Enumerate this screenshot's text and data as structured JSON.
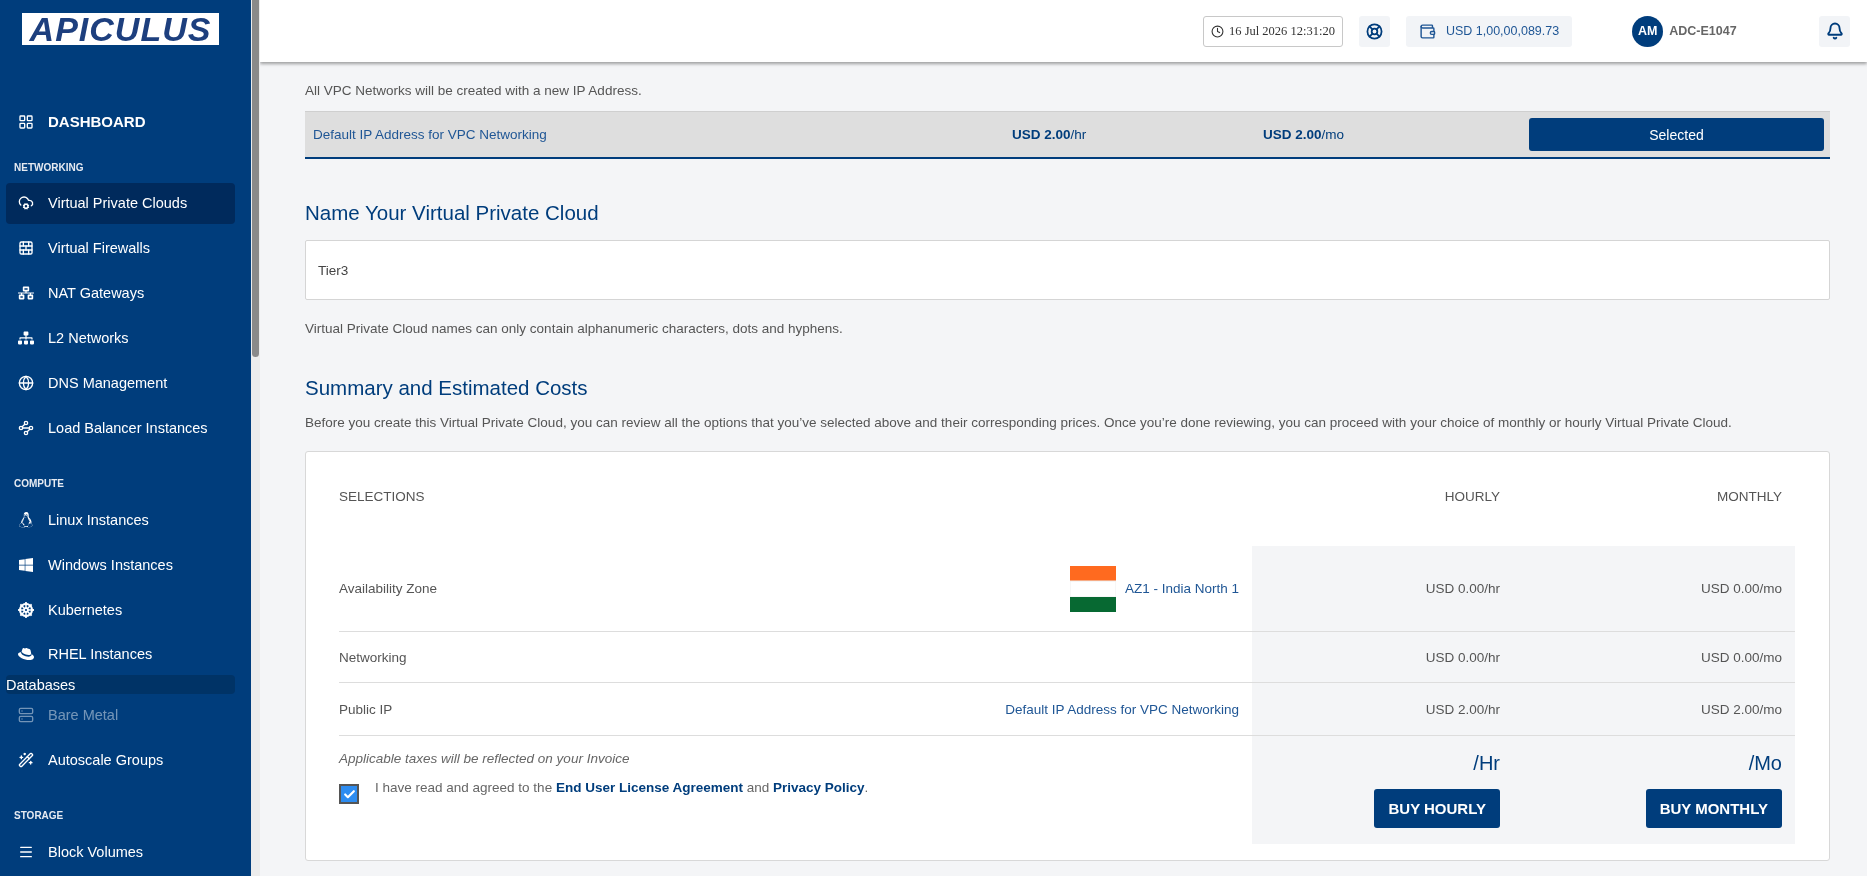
{
  "sidebar": {
    "logo": "APICULUS",
    "items": [
      {
        "kind": "top",
        "label": "DASHBOARD",
        "selected": false
      },
      {
        "kind": "section",
        "label": "NETWORKING"
      },
      {
        "kind": "item",
        "label": "Virtual Private Clouds",
        "selected": true,
        "disabled": false
      },
      {
        "kind": "item",
        "label": "Virtual Firewalls",
        "selected": false,
        "disabled": false
      },
      {
        "kind": "item",
        "label": "NAT Gateways",
        "selected": false,
        "disabled": false
      },
      {
        "kind": "item",
        "label": "L2 Networks",
        "selected": false,
        "disabled": false
      },
      {
        "kind": "item",
        "label": "DNS Management",
        "selected": false,
        "disabled": false
      },
      {
        "kind": "item",
        "label": "Load Balancer Instances",
        "selected": false,
        "disabled": false
      },
      {
        "kind": "section",
        "label": "COMPUTE"
      },
      {
        "kind": "item",
        "label": "Linux Instances",
        "selected": false,
        "disabled": false
      },
      {
        "kind": "item",
        "label": "Windows Instances",
        "selected": false,
        "disabled": false
      },
      {
        "kind": "item",
        "label": "Kubernetes",
        "selected": false,
        "disabled": false
      },
      {
        "kind": "item",
        "label": "RHEL Instances",
        "selected": false,
        "disabled": false
      },
      {
        "kind": "bare",
        "label": "Databases"
      },
      {
        "kind": "item",
        "label": "Bare Metal",
        "selected": false,
        "disabled": true
      },
      {
        "kind": "item",
        "label": "Autoscale Groups",
        "selected": false,
        "disabled": false
      },
      {
        "kind": "section",
        "label": "STORAGE"
      },
      {
        "kind": "item",
        "label": "Block Volumes",
        "selected": false,
        "disabled": false
      }
    ]
  },
  "header": {
    "datetime": "16 Jul 2026 12:31:20",
    "balance": "USD 1,00,00,089.73",
    "avatar": "AM",
    "account": "ADC-E1047"
  },
  "ip_section": {
    "description": "All VPC Networks will be created with a new IP Address.",
    "option": {
      "name": "Default IP Address for VPC Networking",
      "hourly_amount": "USD 2.00",
      "hourly_unit": "/hr",
      "monthly_amount": "USD 2.00",
      "monthly_unit": "/mo",
      "button": "Selected",
      "selected": true
    }
  },
  "name_section": {
    "title": "Name Your Virtual Private Cloud",
    "value": "Tier3",
    "hint": "Virtual Private Cloud names can only contain alphanumeric characters, dots and hyphens."
  },
  "summary": {
    "title": "Summary and Estimated Costs",
    "description": "Before you create this Virtual Private Cloud, you can review all the options that you’ve selected above and their corresponding prices. Once you’re done reviewing, you can proceed with your choice of monthly or hourly Virtual Private Cloud.",
    "columns": [
      "SELECTIONS",
      "HOURLY",
      "MONTHLY"
    ],
    "rows": [
      {
        "kind": "zone",
        "label": "Availability Zone",
        "value": "AZ1 - India North 1",
        "hourly": "USD 0.00/hr",
        "monthly": "USD 0.00/mo"
      },
      {
        "kind": "plain",
        "label": "Networking",
        "hourly": "USD 0.00/hr",
        "monthly": "USD 0.00/mo"
      },
      {
        "kind": "plain",
        "label": "Public IP",
        "value": "Default IP Address for VPC Networking",
        "hourly": "USD 2.00/hr",
        "monthly": "USD 2.00/mo"
      }
    ],
    "tax_note": "Applicable taxes will be reflected on your Invoice",
    "agreement": {
      "checked": true,
      "before": "I have read and agreed to the ",
      "link_1": "End User License Agreement",
      "middle": " and ",
      "link_2": "Privacy Policy",
      "after": "."
    },
    "hourly_total": "/Hr",
    "monthly_total": "/Mo",
    "buy_hourly": "BUY HOURLY",
    "buy_monthly": "BUY MONTHLY"
  }
}
